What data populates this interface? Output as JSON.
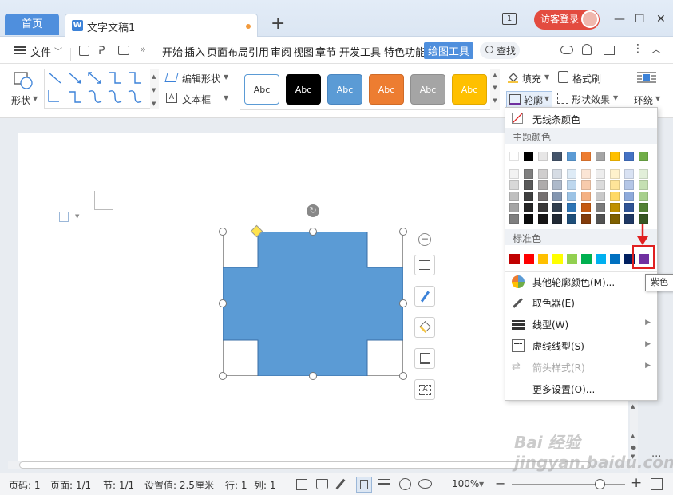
{
  "tabs": {
    "home": "首页",
    "document": "文字文稿1",
    "new_tab": "+"
  },
  "titlebar": {
    "badge": "1",
    "login": "访客登录",
    "minimize": "—",
    "maximize": "☐",
    "close": "✕"
  },
  "menu": {
    "file": "文件",
    "items": [
      "开始",
      "插入",
      "页面布局",
      "引用",
      "审阅",
      "视图",
      "章节",
      "开发工具",
      "特色功能"
    ],
    "active": "绘图工具",
    "search": "查找"
  },
  "ribbon": {
    "shape": "形状",
    "edit_shape": "编辑形状",
    "textbox": "文本框",
    "styles": [
      {
        "label": "Abc",
        "bg": "#ffffff",
        "fg": "#333333",
        "border": "#5b9bd5"
      },
      {
        "label": "Abc",
        "bg": "#000000",
        "fg": "#ffffff",
        "border": "#000000"
      },
      {
        "label": "Abc",
        "bg": "#5b9bd5",
        "fg": "#ffffff",
        "border": "#4a86c0"
      },
      {
        "label": "Abc",
        "bg": "#ed7d31",
        "fg": "#ffffff",
        "border": "#d06b27"
      },
      {
        "label": "Abc",
        "bg": "#a5a5a5",
        "fg": "#ffffff",
        "border": "#8f8f8f"
      },
      {
        "label": "Abc",
        "bg": "#ffc000",
        "fg": "#ffffff",
        "border": "#e0a800"
      }
    ],
    "fill": "填充",
    "format_painter": "格式刷",
    "outline": "轮廓",
    "shape_effects": "形状效果",
    "wrap": "环绕"
  },
  "dropdown": {
    "no_line": "无线条颜色",
    "theme_colors": "主题颜色",
    "standard_colors": "标准色",
    "theme_row": [
      "#ffffff",
      "#000000",
      "#e7e6e6",
      "#44546a",
      "#5b9bd5",
      "#ed7d31",
      "#a5a5a5",
      "#ffc000",
      "#4472c4",
      "#70ad47"
    ],
    "theme_shades": [
      [
        "#f2f2f2",
        "#7f7f7f",
        "#d0cece",
        "#d6dce4",
        "#deebf6",
        "#fbe5d5",
        "#ededed",
        "#fff2cc",
        "#d9e2f3",
        "#e2efd9"
      ],
      [
        "#d8d8d8",
        "#595959",
        "#aeabab",
        "#adb9ca",
        "#bdd7ee",
        "#f7cbac",
        "#dbdbdb",
        "#fee599",
        "#b4c6e7",
        "#c5e0b3"
      ],
      [
        "#bfbfbf",
        "#3f3f3f",
        "#757070",
        "#8496b0",
        "#9cc3e5",
        "#f4b183",
        "#c9c9c9",
        "#ffd965",
        "#8eaadb",
        "#a8d08d"
      ],
      [
        "#a5a5a5",
        "#262626",
        "#3a3838",
        "#323f4f",
        "#2e75b5",
        "#c55a11",
        "#7b7b7b",
        "#bf9000",
        "#2f5496",
        "#538135"
      ],
      [
        "#7f7f7f",
        "#0c0c0c",
        "#171616",
        "#222a35",
        "#1e4e79",
        "#833c0b",
        "#525252",
        "#7f6000",
        "#1f3864",
        "#375623"
      ]
    ],
    "standard_row": [
      "#c00000",
      "#ff0000",
      "#ffc000",
      "#ffff00",
      "#92d050",
      "#00b050",
      "#00b0f0",
      "#0070c0",
      "#002060",
      "#7030a0"
    ],
    "tooltip": "紫色",
    "more_colors": "其他轮廓颜色(M)...",
    "eyedropper": "取色器(E)",
    "line_type": "线型(W)",
    "dash_type": "虚线线型(S)",
    "arrow_style": "箭头样式(R)",
    "more_settings": "更多设置(O)..."
  },
  "shape": {
    "fill": "#5b9bd5",
    "stroke": "#3a6ea5"
  },
  "statusbar": {
    "page_no": "页码: 1",
    "pages": "页面: 1/1",
    "section": "节: 1/1",
    "setting": "设置值: 2.5厘米",
    "row": "行: 1",
    "col": "列: 1",
    "zoom": "100%",
    "zoom_level": 0.78
  },
  "watermark": "Bai 经验 jingyan.baidu.com"
}
